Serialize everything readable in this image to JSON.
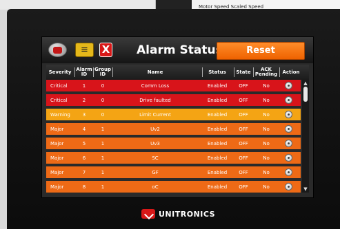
{
  "background_window": {
    "text": "Motor Speed     Scaled Speed"
  },
  "header": {
    "title": "Alarm Status",
    "reset_label": "Reset",
    "close_label": "X",
    "sort_icon": "≡"
  },
  "columns": [
    "Severity",
    "Alarm ID",
    "Group ID",
    "Name",
    "Status",
    "State",
    "ACK Pending",
    "Action"
  ],
  "rows": [
    {
      "severity": "Critical",
      "alarm_id": "1",
      "group_id": "0",
      "name": "Comm Loss",
      "status": "Enabled",
      "state": "OFF",
      "ack": "No",
      "color": "#d8141a"
    },
    {
      "severity": "Critical",
      "alarm_id": "2",
      "group_id": "0",
      "name": "Drive faulted",
      "status": "Enabled",
      "state": "OFF",
      "ack": "No",
      "color": "#d8141a"
    },
    {
      "severity": "Warning",
      "alarm_id": "3",
      "group_id": "0",
      "name": "Limit Current",
      "status": "Enabled",
      "state": "OFF",
      "ack": "No",
      "color": "#f4a414"
    },
    {
      "severity": "Major",
      "alarm_id": "4",
      "group_id": "1",
      "name": "Uv2",
      "status": "Enabled",
      "state": "OFF",
      "ack": "No",
      "color": "#ee6a16"
    },
    {
      "severity": "Major",
      "alarm_id": "5",
      "group_id": "1",
      "name": "Uv3",
      "status": "Enabled",
      "state": "OFF",
      "ack": "No",
      "color": "#ee6a16"
    },
    {
      "severity": "Major",
      "alarm_id": "6",
      "group_id": "1",
      "name": "SC",
      "status": "Enabled",
      "state": "OFF",
      "ack": "No",
      "color": "#ee6a16"
    },
    {
      "severity": "Major",
      "alarm_id": "7",
      "group_id": "1",
      "name": "GF",
      "status": "Enabled",
      "state": "OFF",
      "ack": "No",
      "color": "#ee6a16"
    },
    {
      "severity": "Major",
      "alarm_id": "8",
      "group_id": "1",
      "name": "oC",
      "status": "Enabled",
      "state": "OFF",
      "ack": "No",
      "color": "#ee6a16"
    }
  ],
  "logo": {
    "text": "UNITRONICS"
  }
}
